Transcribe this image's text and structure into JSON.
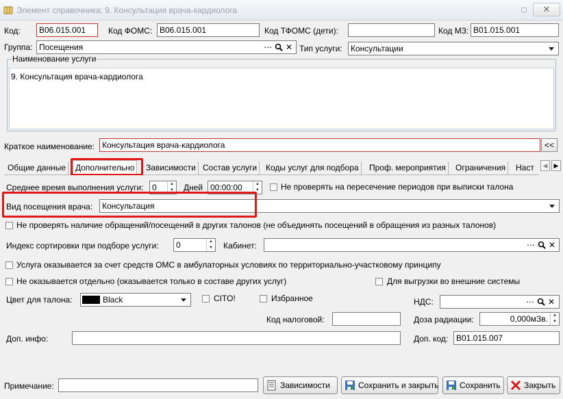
{
  "window": {
    "title": "Элемент справочника: 9. Консультация врача-кардиолога",
    "close_label": "✕",
    "maximize_label": "□"
  },
  "header": {
    "code_label": "Код:",
    "code_value": "B06.015.001",
    "foms_label": "Код ФОМС:",
    "foms_value": "B06.015.001",
    "tfoms_label": "Код ТФОМС (дети):",
    "tfoms_value": "",
    "mz_label": "Код МЗ:",
    "mz_value": "B01.015.001",
    "group_label": "Группа:",
    "group_value": "Посещения",
    "service_type_label": "Тип услуги:",
    "service_type_value": "Консультации"
  },
  "service_name": {
    "legend": "Наименование услуги",
    "value": "9. Консультация врача-кардиолога"
  },
  "short_name": {
    "label": "Краткое наименование:",
    "value": "Консультация врача-кардиолога",
    "copy_button": "<<"
  },
  "tabs": [
    {
      "label": "Общие данные"
    },
    {
      "label": "Дополнительно"
    },
    {
      "label": "Зависимости"
    },
    {
      "label": "Состав услуги"
    },
    {
      "label": "Коды услуг для подбора"
    },
    {
      "label": "Проф. мероприятия"
    },
    {
      "label": "Ограничения"
    },
    {
      "label": "Наст"
    }
  ],
  "additional": {
    "avg_time_label": "Среднее время выполнения услуги:",
    "avg_days_value": "0",
    "days_label": "Дней",
    "avg_time_value": "00:00:00",
    "no_check_periods_label": "Не проверять на пересечение периодов при выписки талона",
    "visit_type_label": "Вид посещения врача:",
    "visit_type_value": "Консультация",
    "no_check_visits_label": "Не проверять наличие обращений/посещений в других талонов (не объединять посещений в обращения из разных талонов)",
    "sort_index_label": "Индекс сортировки при подборе услуги:",
    "sort_index_value": "0",
    "cabinet_label": "Кабинет:",
    "cabinet_value": "",
    "oms_label": "Услуга оказывается за счет средств ОМС в амбулаторных условиях по территориально-участковому принципу",
    "not_separate_label": "Не оказывается отдельно (оказывается только в составе других услуг)",
    "export_label": "Для выгрузки во внешние системы",
    "ticket_color_label": "Цвет для талона:",
    "ticket_color_value": "Black",
    "ticket_color_hex": "#000000",
    "cito_label": "CITO!",
    "favorite_label": "Избранное",
    "vat_label": "НДС:",
    "vat_value": "",
    "tax_code_label": "Код налоговой:",
    "tax_code_value": "",
    "radiation_label": "Доза радиации:",
    "radiation_value": "0,000мЗв.",
    "extra_info_label": "Доп. инфо:",
    "extra_info_value": "",
    "extra_code_label": "Доп. код:",
    "extra_code_value": "B01.015.007"
  },
  "footer": {
    "note_label": "Примечание:",
    "note_value": "",
    "deps_button": "Зависимости",
    "save_close_button": "Сохранить и закрыть",
    "save_button": "Сохранить",
    "close_button": "Закрыть"
  },
  "colors": {
    "highlight_red": "#e01818",
    "required_border": "#d23232",
    "groupbox_border": "#a9b8c8"
  }
}
